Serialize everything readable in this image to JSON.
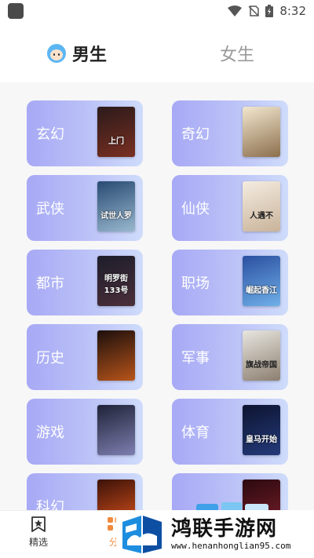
{
  "status_bar": {
    "time": "8:32"
  },
  "tabs": [
    {
      "label": "男生"
    },
    {
      "label": "女生"
    }
  ],
  "categories": [
    {
      "label": "玄幻",
      "cover_text": "上门",
      "cover_colors": [
        "#2a1a1a",
        "#7a2f22"
      ]
    },
    {
      "label": "奇幻",
      "cover_text": "",
      "cover_colors": [
        "#f2e7cf",
        "#8c6f4d"
      ]
    },
    {
      "label": "武侠",
      "cover_text": "试世人罗",
      "cover_colors": [
        "#274a72",
        "#9ab8cf"
      ]
    },
    {
      "label": "仙侠",
      "cover_text": "人遇不",
      "cover_colors": [
        "#f4ece1",
        "#c9b39a"
      ]
    },
    {
      "label": "都市",
      "cover_text": "明罗街133号",
      "cover_colors": [
        "#1d1d2b",
        "#4b2f3a"
      ]
    },
    {
      "label": "职场",
      "cover_text": "崛起香江",
      "cover_colors": [
        "#2b4fa0",
        "#6fb0e8"
      ]
    },
    {
      "label": "历史",
      "cover_text": "",
      "cover_colors": [
        "#1c0f0c",
        "#b8541a"
      ]
    },
    {
      "label": "军事",
      "cover_text": "旗战帝国",
      "cover_colors": [
        "#e8e6e0",
        "#8c7f70"
      ]
    },
    {
      "label": "游戏",
      "cover_text": "",
      "cover_colors": [
        "#1f2238",
        "#7e7fb0"
      ]
    },
    {
      "label": "体育",
      "cover_text": "皇马开始",
      "cover_colors": [
        "#0d1430",
        "#243a7a"
      ]
    },
    {
      "label": "科幻",
      "cover_text": "",
      "cover_colors": [
        "#3b1208",
        "#e0541e"
      ]
    },
    {
      "label": "",
      "cover_text": "",
      "cover_colors": [
        "#2b0a0f",
        "#7a1e2a"
      ]
    }
  ],
  "bottom_nav": [
    {
      "label": "精选",
      "icon": "star-bookmark-icon"
    },
    {
      "label": "分",
      "icon": "category-icon"
    }
  ],
  "watermark": {
    "name": "鸿联手游网",
    "url": "www.henanhonglian95.com"
  }
}
